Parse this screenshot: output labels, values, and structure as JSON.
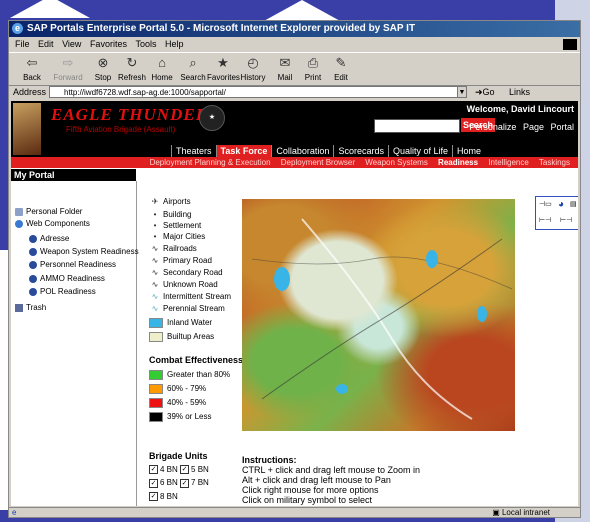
{
  "window": {
    "title": "SAP Portals Enterprise Portal 5.0 - Microsoft Internet Explorer provided by SAP IT",
    "menu": [
      "File",
      "Edit",
      "View",
      "Favorites",
      "Tools",
      "Help"
    ],
    "toolbar": [
      "Back",
      "Forward",
      "Stop",
      "Refresh",
      "Home",
      "Search",
      "Favorites",
      "History",
      "Mail",
      "Print",
      "Edit"
    ],
    "address_label": "Address",
    "address_value": "http://iwdf6728.wdf.sap-ag.de:1000/sapportal/",
    "go_label": "Go",
    "links_label": "Links",
    "status_text": "Local intranet"
  },
  "header": {
    "logo_title": "EAGLE THUNDER",
    "logo_subtitle": "Fifth Aviation Brigade (Assault)",
    "welcome": "Welcome, David Lincourt",
    "search_button": "Search",
    "personalize": [
      "Personalize",
      "Page",
      "Portal"
    ]
  },
  "tabs": [
    {
      "label": "Theaters",
      "active": false
    },
    {
      "label": "Task Force",
      "active": true
    },
    {
      "label": "Collaboration",
      "active": false
    },
    {
      "label": "Scorecards",
      "active": false
    },
    {
      "label": "Quality of Life",
      "active": false
    },
    {
      "label": "Home",
      "active": false
    }
  ],
  "subnav": [
    {
      "label": "Deployment Planning & Execution",
      "active": false
    },
    {
      "label": "Deployment Browser",
      "active": false
    },
    {
      "label": "Weapon Systems",
      "active": false
    },
    {
      "label": "Readiness",
      "active": true
    },
    {
      "label": "Intelligence",
      "active": false
    },
    {
      "label": "Taskings",
      "active": false
    }
  ],
  "my_portal": {
    "title": "My Portal",
    "items": [
      {
        "label": "Personal Folder",
        "icon": "folder-icon",
        "indent": 0
      },
      {
        "label": "Web Components",
        "icon": "globe-icon",
        "indent": 0
      },
      {
        "label": "Adresse",
        "icon": "page-icon",
        "indent": 1
      },
      {
        "label": "Weapon System Readiness",
        "icon": "page-icon",
        "indent": 1
      },
      {
        "label": "Personnel Readiness",
        "icon": "page-icon",
        "indent": 1
      },
      {
        "label": "AMMO Readiness",
        "icon": "page-icon",
        "indent": 1
      },
      {
        "label": "POL Readiness",
        "icon": "page-icon",
        "indent": 1
      },
      {
        "label": "Trash",
        "icon": "trash-icon",
        "indent": 0
      }
    ]
  },
  "legend": {
    "items": [
      {
        "label": "Airports",
        "symbol": "✈"
      },
      {
        "label": "Building",
        "symbol": "•"
      },
      {
        "label": "Settlement",
        "symbol": "•"
      },
      {
        "label": "Major Cities",
        "symbol": "•"
      },
      {
        "label": "Railroads",
        "symbol": "∿"
      },
      {
        "label": "Primary Road",
        "symbol": "∿"
      },
      {
        "label": "Secondary Road",
        "symbol": "∿"
      },
      {
        "label": "Unknown Road",
        "symbol": "∿"
      },
      {
        "label": "Intermittent Stream",
        "symbol": "∿"
      },
      {
        "label": "Perennial Stream",
        "symbol": "∿"
      },
      {
        "label": "Inland Water",
        "swatch": "#39b4e6"
      },
      {
        "label": "Builtup Areas",
        "swatch": "#efeecb"
      }
    ],
    "combat_title": "Combat Effectiveness",
    "combat": [
      {
        "label": "Greater than 80%",
        "color": "#33cc33"
      },
      {
        "label": "60% - 79%",
        "color": "#ff9900"
      },
      {
        "label": "40% - 59%",
        "color": "#ee1111"
      },
      {
        "label": "39% or  Less",
        "color": "#000000"
      }
    ],
    "brigade_title": "Brigade Units",
    "brigade": [
      [
        "4 BN",
        "5 BN"
      ],
      [
        "6 BN",
        "7 BN"
      ],
      [
        "8 BN"
      ]
    ]
  },
  "instructions": {
    "title": "Instructions:",
    "lines": [
      "CTRL + click and drag left mouse to Zoom in",
      "Alt + click and drag left mouse to Pan",
      "Click right mouse for more options",
      "Click on military symbol to select"
    ]
  }
}
